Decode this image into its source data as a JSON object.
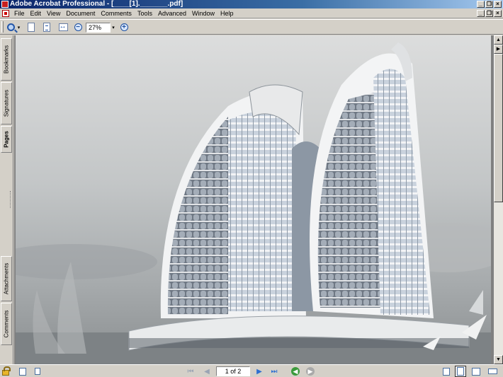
{
  "window": {
    "title": "Adobe Acrobat Professional - [____[1]._______.pdf]",
    "min_glyph": "_",
    "max_glyph": "❐",
    "close_glyph": "×"
  },
  "menu": {
    "items": [
      "File",
      "Edit",
      "View",
      "Document",
      "Comments",
      "Tools",
      "Advanced",
      "Window",
      "Help"
    ]
  },
  "toolbar": {
    "zoom_value": "27%",
    "zoom_out_glyph": "−",
    "zoom_in_glyph": "+",
    "dropdown_glyph": "▾"
  },
  "nav_tabs": {
    "bookmarks": "Bookmarks",
    "signatures": "Signatures",
    "pages": "Pages",
    "attachments": "Attachments",
    "comments": "Comments"
  },
  "scrollbar": {
    "up_glyph": "▲",
    "down_glyph": "▼",
    "right_arrow_glyph": "▶"
  },
  "status": {
    "page_indicator": "1 of 2",
    "first_glyph": "⏮",
    "prev_glyph": "◀",
    "next_glyph": "▶",
    "last_glyph": "⏭",
    "back_glyph": "◀",
    "forward_glyph": "▶"
  },
  "icons": {
    "app": "acrobat-icon",
    "zoom_tool": "zoom-tool-icon",
    "actual_size": "actual-size-icon",
    "fit_page": "fit-page-icon",
    "fit_width": "fit-width-icon",
    "zoom_out": "zoom-out-icon",
    "zoom_in": "zoom-in-icon",
    "lock": "lock-icon"
  },
  "colors": {
    "title_bar": "#0a246a",
    "chrome": "#d4d0c8",
    "doc_background": "#808080",
    "nav_active": "#2d6fd1"
  }
}
